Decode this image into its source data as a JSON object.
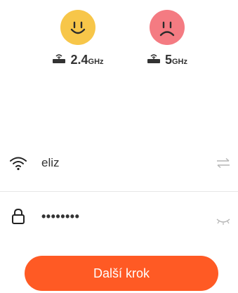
{
  "bands": [
    {
      "status": "supported",
      "face": "smiley-face-icon",
      "color": "#f7c649",
      "value": "2.4",
      "unit": "GHz"
    },
    {
      "status": "unsupported",
      "face": "sad-face-icon",
      "color": "#f47b82",
      "value": "5",
      "unit": "GHz"
    }
  ],
  "wifi": {
    "icon": "wifi-icon",
    "ssid": "eliz",
    "action_icon": "switch-network-icon"
  },
  "password": {
    "icon": "lock-icon",
    "value": "••••••••",
    "action_icon": "eye-closed-icon"
  },
  "next_button": {
    "label": "Další krok",
    "color": "#ff5a24"
  }
}
